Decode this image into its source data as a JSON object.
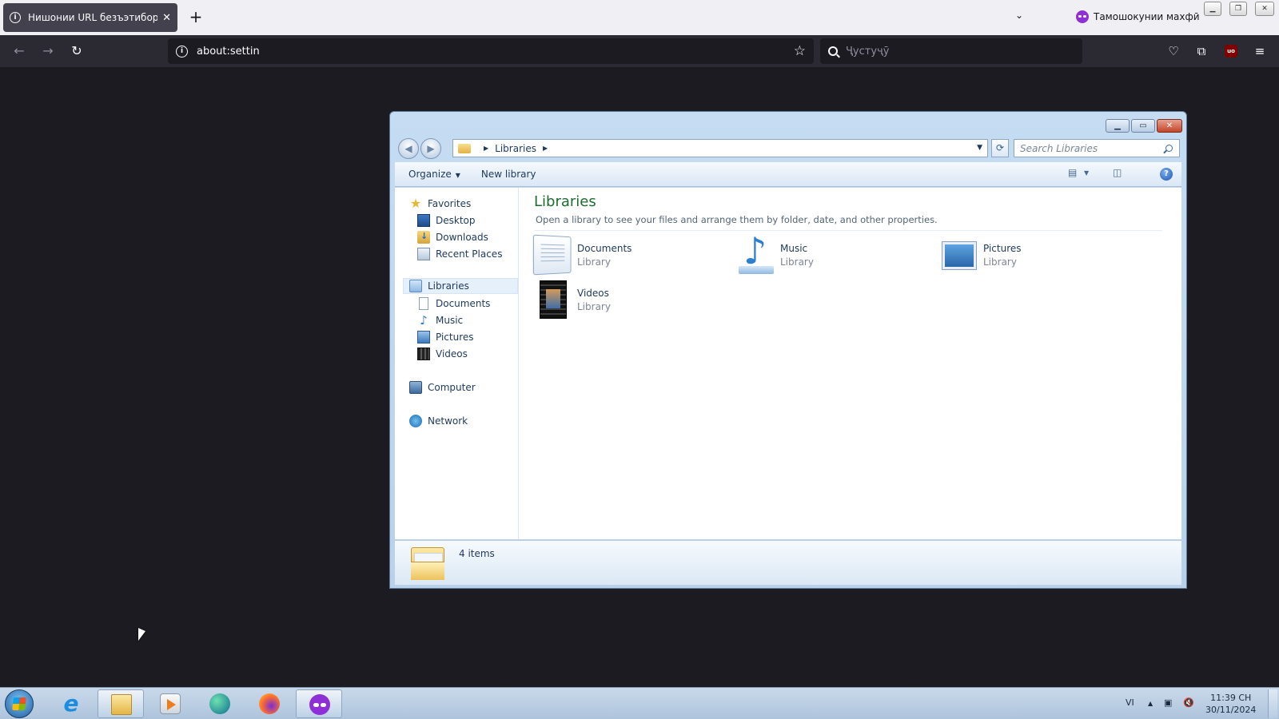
{
  "browser": {
    "tab": {
      "title": "Нишонии URL безъэтибор аст",
      "close_glyph": "✕"
    },
    "new_tab_glyph": "+",
    "tab_list_glyph": "⌄",
    "private_label": "Тамошокунии махфӣ",
    "window_controls": [
      "▁",
      "❐",
      "✕"
    ],
    "nav": {
      "back": "←",
      "forward": "→",
      "reload": "↻"
    },
    "url": "about:settin",
    "bookmark_glyph": "☆",
    "search_placeholder": "Ҷустуҷӯ",
    "toolbar_icons": [
      "pocket-icon",
      "extensions-icon",
      "ublock-icon",
      "menu-icon"
    ],
    "ublock_label": "uo"
  },
  "explorer": {
    "window_controls": [
      "▁",
      "▭",
      "✕"
    ],
    "nav": {
      "back": "◀",
      "forward": "▶"
    },
    "address": {
      "path": [
        "Libraries"
      ],
      "sep": "▶",
      "dropdown": "▼"
    },
    "refresh_glyph": "⟳",
    "search_placeholder": "Search Libraries",
    "toolbar": {
      "organize": "Organize",
      "new_library": "New library",
      "arrow": "▼"
    },
    "sidebar": {
      "favorites": "Favorites",
      "favorites_items": [
        "Desktop",
        "Downloads",
        "Recent Places"
      ],
      "libraries": "Libraries",
      "libraries_items": [
        "Documents",
        "Music",
        "Pictures",
        "Videos"
      ],
      "computer": "Computer",
      "network": "Network"
    },
    "main": {
      "title": "Libraries",
      "description": "Open a library to see your files and arrange them by folder, date, and other properties.",
      "items": [
        {
          "name": "Documents",
          "type": "Library"
        },
        {
          "name": "Music",
          "type": "Library"
        },
        {
          "name": "Pictures",
          "type": "Library"
        },
        {
          "name": "Videos",
          "type": "Library"
        }
      ]
    },
    "details": {
      "count": "4 items"
    }
  },
  "taskbar": {
    "apps": [
      "internet-explorer",
      "windows-explorer",
      "media-player",
      "edge",
      "firefox",
      "firefox-private"
    ],
    "tray": {
      "lang": "VI",
      "show_hidden": "▲"
    },
    "clock": {
      "time": "11:39 CH",
      "date": "30/11/2024"
    }
  },
  "colors": {
    "browser_dark": "#2b2a33",
    "page_bg": "#1c1b22",
    "explorer_frame": "#c5dcf2",
    "library_title": "#1e6b30"
  }
}
